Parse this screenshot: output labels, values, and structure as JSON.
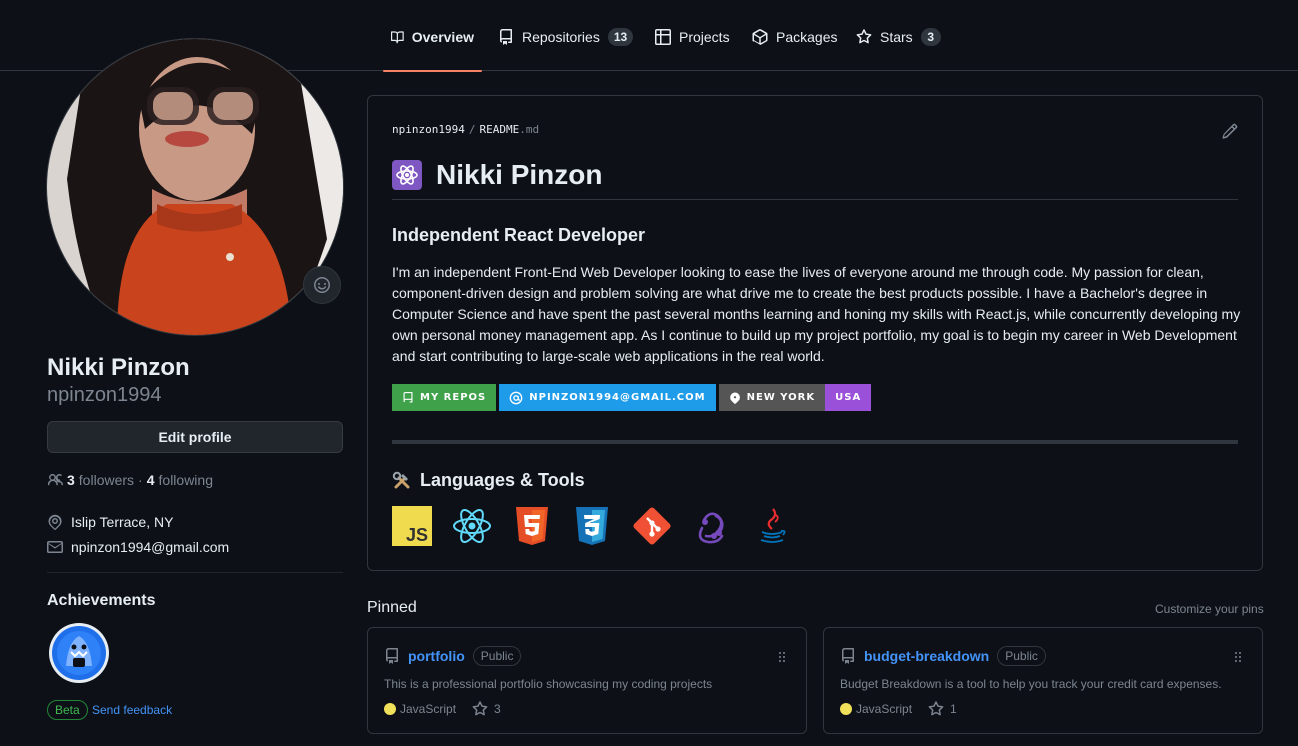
{
  "nav": {
    "tabs": [
      {
        "label": "Overview",
        "icon": "book-icon"
      },
      {
        "label": "Repositories",
        "count": "13",
        "icon": "repo-icon"
      },
      {
        "label": "Projects",
        "icon": "table-icon"
      },
      {
        "label": "Packages",
        "icon": "package-icon"
      },
      {
        "label": "Stars",
        "count": "3",
        "icon": "star-icon"
      }
    ]
  },
  "profile": {
    "name": "Nikki Pinzon",
    "username": "npinzon1994",
    "edit_label": "Edit profile",
    "followers_count": "3",
    "followers_label": "followers",
    "separator": "·",
    "following_count": "4",
    "following_label": "following",
    "location": "Islip Terrace, NY",
    "email": "npinzon1994@gmail.com"
  },
  "achievements": {
    "title": "Achievements",
    "beta": "Beta",
    "feedback": "Send feedback"
  },
  "readme": {
    "owner": "npinzon1994",
    "slash": "/",
    "file": "README",
    "ext": ".md",
    "heading": "Nikki Pinzon",
    "subheading": "Independent React Developer",
    "paragraph": "I'm an independent Front-End Web Developer looking to ease the lives of everyone around me through code. My passion for clean, component-driven design and problem solving are what drive me to create the best products possible. I have a Bachelor's degree in Computer Science and have spent the past several months learning and honing my skills with React.js, while concurrently developing my own personal money management app. As I continue to build up my project portfolio, my goal is to begin my career in Web Development and start contributing to large-scale web applications in the real world.",
    "shields": {
      "repos": "MY REPOS",
      "email": "NPINZON1994@GMAIL.COM",
      "location_left": "NEW YORK",
      "location_right": "USA"
    },
    "tools_title": "Languages & Tools",
    "tools": [
      "javascript",
      "react",
      "html5",
      "css3",
      "git",
      "redux",
      "java"
    ]
  },
  "pinned": {
    "title": "Pinned",
    "customize": "Customize your pins",
    "items": [
      {
        "name": "portfolio",
        "visibility": "Public",
        "description": "This is a professional portfolio showcasing my coding projects",
        "language": "JavaScript",
        "stars": "3"
      },
      {
        "name": "budget-breakdown",
        "visibility": "Public",
        "description": "Budget Breakdown is a tool to help you track your credit card expenses.",
        "language": "JavaScript",
        "stars": "1"
      }
    ]
  },
  "colors": {
    "accent_tab": "#f78166",
    "link": "#4493f8",
    "js_dot": "#f1e05a",
    "shield_repos": "#3fa24b",
    "shield_email": "#1e9be9",
    "shield_location_left": "#555555",
    "shield_location_right": "#9a50d8"
  }
}
